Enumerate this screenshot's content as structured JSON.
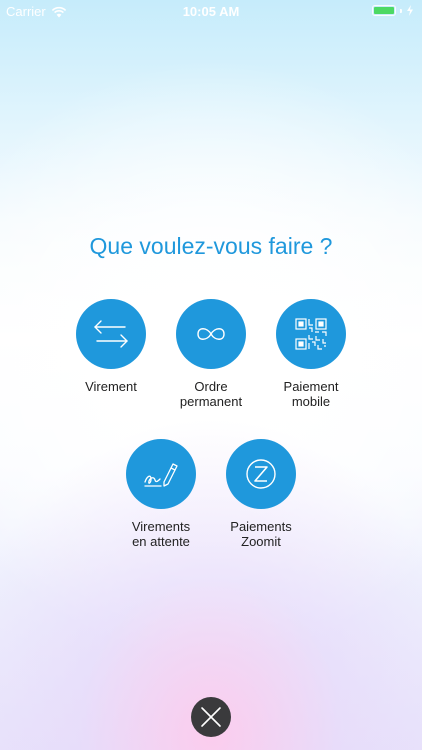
{
  "status_bar": {
    "carrier": "Carrier",
    "time": "10:05 AM",
    "battery_level": 1.0,
    "icons": [
      "wifi-icon",
      "battery-icon",
      "charging-icon"
    ]
  },
  "title": "Que voulez-vous faire ?",
  "actions": [
    {
      "label": "Virement",
      "icon": "transfer-arrows-icon"
    },
    {
      "label": "Ordre\npermanent",
      "icon": "infinity-icon"
    },
    {
      "label": "Paiement\nmobile",
      "icon": "qr-code-icon"
    },
    {
      "label": "Virements\nen attente",
      "icon": "signature-pen-icon"
    },
    {
      "label": "Paiements\nZoomit",
      "icon": "zoomit-icon"
    }
  ],
  "close": {
    "icon": "close-icon"
  },
  "colors": {
    "accent": "#1f98dc",
    "close_bg": "#3a3a3c",
    "battery": "#4cd964"
  }
}
